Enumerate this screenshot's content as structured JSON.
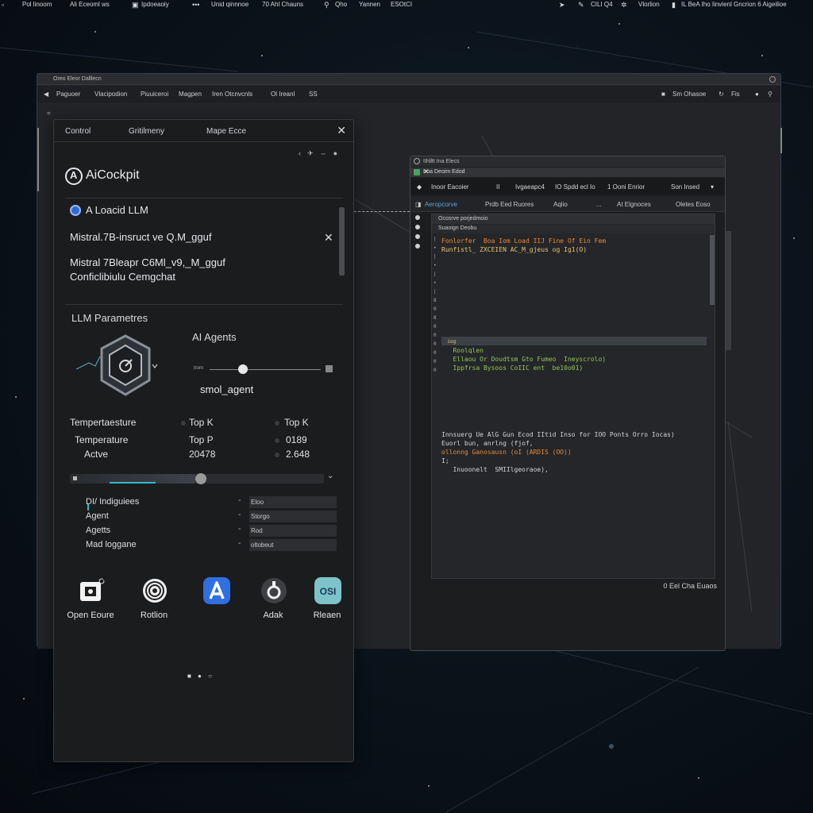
{
  "topbar": {
    "items": [
      "Pol linoom",
      "Ali Eceoml ws",
      "Ipdoeaoiy",
      "Unid qinnnoe",
      "70 Ahl Chauns",
      "Qho",
      "Yannen",
      "ESOtCI"
    ],
    "right_items": [
      "CILI Q4",
      "Vlorlion",
      "IL BeA  Iho Iinvienl Gncrion 6 Aigeilioe"
    ]
  },
  "main_window": {
    "title": "Oreo Eleor Dalllecn",
    "toolbar_items": [
      "Paguoer",
      "Vlacipodion",
      "Piuuiceroi",
      "Magpen",
      "Iren Otcnvcnls",
      "Ol Ireanl",
      "SS"
    ],
    "toolbar_right": [
      "Sm Ohasoe",
      "Fis"
    ]
  },
  "panel": {
    "tabs": [
      "Control",
      "Gritilmeny",
      "Mape Ecce"
    ],
    "brand": "AiCockpit",
    "loaded_label": "A Loacid LLM",
    "model_1": "Mistral.7B-insruct ve Q.M_gguf",
    "model_2": "Mistral 7Bleapr C6Ml_v9,_M_gguf",
    "model_3": "Conficlibiulu Cemgchat",
    "llm_params_title": "LLM Parametres",
    "ai_agents_title": "AI Agents",
    "slider_label": "trom",
    "agent_name": "smol_agent",
    "param_rows": [
      [
        "Tempertaesture",
        "Top K",
        "Top K"
      ],
      [
        "Temperature",
        "Top P",
        "0189"
      ],
      [
        "Actve",
        "20478",
        "2.648"
      ]
    ],
    "list_rows": [
      {
        "label": "DI/ Indiguiees",
        "value": "Eloo"
      },
      {
        "label": "Agent",
        "value": "Storgo"
      },
      {
        "label": "Agetts",
        "value": "Rod"
      },
      {
        "label": "Mad loggane",
        "value": "oltobeut"
      }
    ],
    "apps": [
      {
        "label": "Open Eoure",
        "icon": "open-source-icon"
      },
      {
        "label": "Rotlion",
        "icon": "rotation-icon"
      },
      {
        "label": "",
        "icon": "a-app-icon"
      },
      {
        "label": "Adak",
        "icon": "adak-icon"
      },
      {
        "label": "Rleaen",
        "icon": "osi-icon",
        "glyph": "OSI"
      }
    ]
  },
  "code_window": {
    "title": "IIhlltt Ina Elecs",
    "subtitle": "Iroa Deoim Edod",
    "toolbar": [
      "Inoor Eacoier",
      "II",
      "Ivgaeapc4",
      "IO Spdd ecl Io",
      "1 Ooni Enrior",
      "Son Insed"
    ],
    "tabs": [
      "Aeropcorve",
      "Prdb Eed Ruores",
      "Aqiio",
      "...",
      "At Elgnoces",
      "Oletes Eoso"
    ],
    "editor_header": "Ocosrve  porjedmoio",
    "editor_sub": "Suaoign Deobu",
    "code_lines": [
      {
        "text": "Fonlorfer  Boa Iom Load IIJ Fine Of Ein Fem",
        "color": "#e58a3a"
      },
      {
        "text": "Runfistl_ ZXCEIEN AC_M_gjeus og Ig1(O)",
        "color": "#e6c86a"
      },
      {
        "text": "  iog",
        "color": "#e6c86a"
      },
      {
        "text": "   Roolqlen",
        "color": "#97c459"
      },
      {
        "text": "   Ellaou Or Doudtsm Gto Fumeo  Ineyscrolo)",
        "color": "#97c459"
      },
      {
        "text": "   Ippfrsa Bysoos CoIIC ent  be10o01)",
        "color": "#97c459"
      },
      {
        "text": "Innsuerg Ue AlG Gun Ecod IItid Inso for IOO Ponts Orro Iocas)",
        "color": "#d4d4d4"
      },
      {
        "text": "Euorl bun, anrlng (fjof,",
        "color": "#d4d4d4"
      },
      {
        "text": "ollonng Ganosausn (oI (ARDIS (OO))",
        "color": "#e58a3a"
      },
      {
        "text": "I;",
        "color": "#d4d4d4"
      },
      {
        "text": "   Inuoonelt  SMIIlgeoraoe),",
        "color": "#d4d4d4"
      }
    ],
    "status": "0 Eel Cha Euaos"
  }
}
